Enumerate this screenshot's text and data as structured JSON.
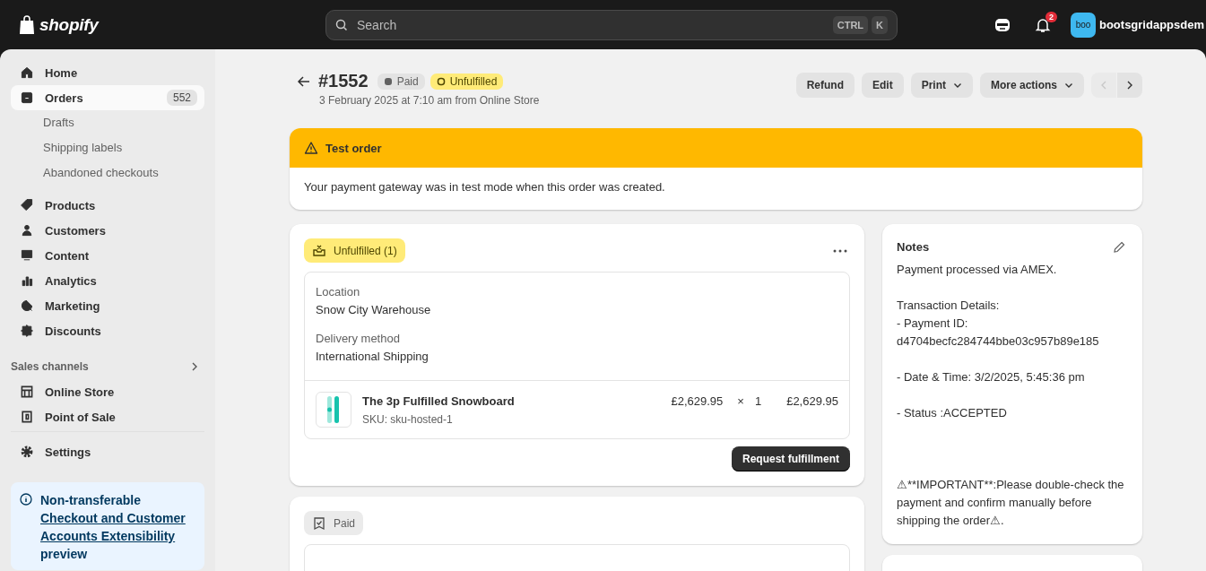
{
  "topbar": {
    "logo": "shopify",
    "search": {
      "placeholder": "Search",
      "shortcut_keys": [
        "CTRL",
        "K"
      ]
    },
    "notification_count": "2",
    "avatar_initials": "boo",
    "store_name": "bootsgridappsdem"
  },
  "sidebar": {
    "items": [
      {
        "label": "Home",
        "selected": false
      },
      {
        "label": "Orders",
        "selected": true,
        "count": "552",
        "children": [
          {
            "label": "Drafts",
            "selected": false
          },
          {
            "label": "Shipping labels",
            "selected": false
          },
          {
            "label": "Abandoned checkouts",
            "selected": false
          }
        ]
      },
      {
        "label": "Products",
        "selected": false
      },
      {
        "label": "Customers",
        "selected": false
      },
      {
        "label": "Content",
        "selected": false
      },
      {
        "label": "Analytics",
        "selected": false
      },
      {
        "label": "Marketing",
        "selected": false
      },
      {
        "label": "Discounts",
        "selected": false
      }
    ],
    "sales_channels": {
      "title": "Sales channels",
      "items": [
        {
          "label": "Online Store",
          "selected": false
        },
        {
          "label": "Point of Sale",
          "selected": false
        }
      ]
    },
    "settings": {
      "label": "Settings",
      "selected": false
    },
    "notice": {
      "text": "Non-transferable",
      "link": "Checkout and Customer Accounts Extensibility",
      "suffix": "preview"
    }
  },
  "order": {
    "number": "#1552",
    "badges": [
      {
        "label": "Paid",
        "kind": "payment"
      },
      {
        "label": "Unfulfilled",
        "kind": "fulfillment"
      }
    ],
    "subtitle": "3 February 2025 at 7:10 am from Online Store",
    "actions": [
      {
        "label": "Refund",
        "dropdown": false
      },
      {
        "label": "Edit",
        "dropdown": false
      },
      {
        "label": "Print",
        "dropdown": true
      },
      {
        "label": "More actions",
        "dropdown": true
      }
    ],
    "pager": {
      "previous": {
        "disabled": true
      },
      "next": {
        "disabled": false
      }
    }
  },
  "banner": {
    "title": "Test order",
    "message": "Your payment gateway was in test mode when this order was created."
  },
  "fulfillment": {
    "status": "Unfulfilled (1)",
    "fields": [
      {
        "label": "Location",
        "value": "Snow City Warehouse"
      },
      {
        "label": "Delivery method",
        "value": "International Shipping"
      }
    ],
    "line_items": [
      {
        "name": "The 3p Fulfilled Snowboard",
        "sku": "SKU: sku-hosted-1",
        "price": "£2,629.95",
        "times": "×",
        "quantity": "1",
        "total": "£2,629.95"
      }
    ],
    "action": "Request fulfillment"
  },
  "payment": {
    "status": "Paid"
  },
  "notes": {
    "title": "Notes",
    "text": "Payment processed via AMEX.\n\nTransaction Details:\n- Payment ID:\nd4704becfc284744bbe03c957b89e185\n\n- Date & Time: 3/2/2025, 5:45:36 pm\n\n- Status :ACCEPTED\n\n\n\n⚠**IMPORTANT**:Please double-check the payment and confirm manually before shipping the order⚠."
  }
}
